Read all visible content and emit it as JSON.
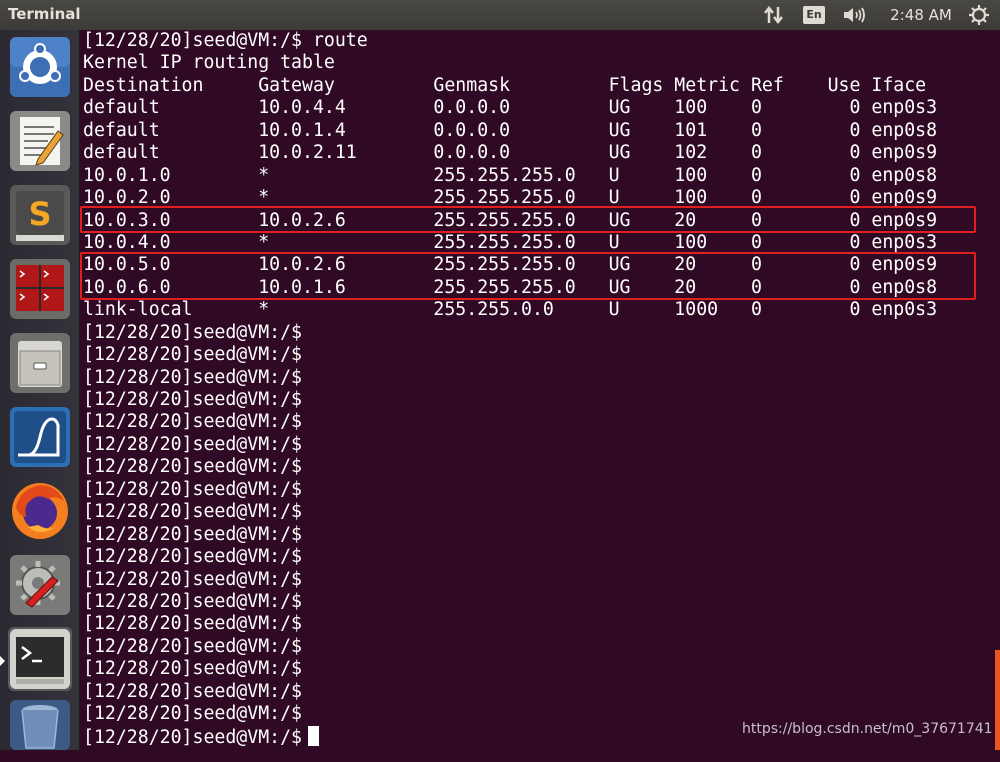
{
  "topbar": {
    "app_title": "Terminal",
    "keyboard_layout": "En",
    "clock": "2:48 AM",
    "icons": [
      "network-arrows-icon",
      "keyboard-layout-icon",
      "volume-icon",
      "session-gear-icon"
    ]
  },
  "launcher": {
    "items": [
      {
        "name": "dash-home",
        "icon": "ubuntu-logo-icon"
      },
      {
        "name": "text-editor",
        "icon": "text-editor-icon"
      },
      {
        "name": "sublime-text",
        "icon": "sublime-s-icon"
      },
      {
        "name": "terminator",
        "icon": "terminator-icon"
      },
      {
        "name": "file-manager",
        "icon": "file-cabinet-icon"
      },
      {
        "name": "wireshark",
        "icon": "wireshark-fin-icon"
      },
      {
        "name": "firefox",
        "icon": "firefox-icon"
      },
      {
        "name": "system-settings",
        "icon": "settings-wrench-icon"
      },
      {
        "name": "terminal",
        "icon": "terminal-icon",
        "active": true
      },
      {
        "name": "trash",
        "icon": "trash-icon"
      }
    ]
  },
  "terminal": {
    "lines": [
      "[12/28/20]seed@VM:/$ route",
      "Kernel IP routing table",
      "Destination     Gateway         Genmask         Flags Metric Ref    Use Iface",
      "default         10.0.4.4        0.0.0.0         UG    100    0        0 enp0s3",
      "default         10.0.1.4        0.0.0.0         UG    101    0        0 enp0s8",
      "default         10.0.2.11       0.0.0.0         UG    102    0        0 enp0s9",
      "10.0.1.0        *               255.255.255.0   U     100    0        0 enp0s8",
      "10.0.2.0        *               255.255.255.0   U     100    0        0 enp0s9",
      "10.0.3.0        10.0.2.6        255.255.255.0   UG    20     0        0 enp0s9",
      "10.0.4.0        *               255.255.255.0   U     100    0        0 enp0s3",
      "10.0.5.0        10.0.2.6        255.255.255.0   UG    20     0        0 enp0s9",
      "10.0.6.0        10.0.1.6        255.255.255.0   UG    20     0        0 enp0s8",
      "link-local      *               255.255.0.0     U     1000   0        0 enp0s3",
      "[12/28/20]seed@VM:/$",
      "[12/28/20]seed@VM:/$",
      "[12/28/20]seed@VM:/$",
      "[12/28/20]seed@VM:/$",
      "[12/28/20]seed@VM:/$",
      "[12/28/20]seed@VM:/$",
      "[12/28/20]seed@VM:/$",
      "[12/28/20]seed@VM:/$",
      "[12/28/20]seed@VM:/$",
      "[12/28/20]seed@VM:/$",
      "[12/28/20]seed@VM:/$",
      "[12/28/20]seed@VM:/$",
      "[12/28/20]seed@VM:/$",
      "[12/28/20]seed@VM:/$",
      "[12/28/20]seed@VM:/$",
      "[12/28/20]seed@VM:/$",
      "[12/28/20]seed@VM:/$",
      "[12/28/20]seed@VM:/$",
      "[12/28/20]seed@VM:/$"
    ],
    "highlighted_rows": [
      "10.0.3.0",
      "10.0.5.0",
      "10.0.6.0"
    ],
    "colors": {
      "background": "#300a24",
      "text": "#ffffff",
      "highlight": "#e02020"
    }
  },
  "watermark": "https://blog.csdn.net/m0_37671741"
}
